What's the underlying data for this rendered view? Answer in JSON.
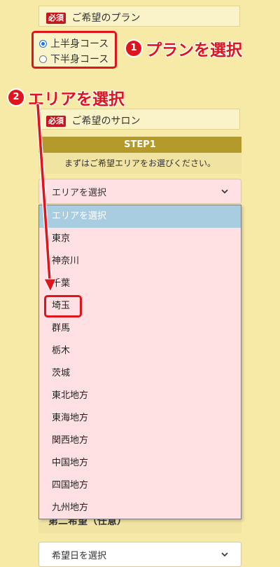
{
  "required_badge": "必須",
  "plan": {
    "title": "ご希望のプラン",
    "options": [
      {
        "label": "上半身コース",
        "checked": true
      },
      {
        "label": "下半身コース",
        "checked": false
      }
    ]
  },
  "salon": {
    "title": "ご希望のサロン"
  },
  "step": {
    "header": "STEP1",
    "description": "まずはご希望エリアをお選びください。"
  },
  "area_select": {
    "value": "エリアを選択",
    "options": [
      "エリアを選択",
      "東京",
      "神奈川",
      "千葉",
      "埼玉",
      "群馬",
      "栃木",
      "茨城",
      "東北地方",
      "東海地方",
      "関西地方",
      "中国地方",
      "四国地方",
      "九州地方"
    ]
  },
  "second_choice": {
    "label": "第二希望（任意）"
  },
  "date_select": {
    "value": "希望日を選択"
  },
  "callouts": {
    "one": {
      "number": "1",
      "text": "プランを選択"
    },
    "two": {
      "number": "2",
      "text": "エリアを選択"
    }
  },
  "colors": {
    "background": "#f7eaa6",
    "accent_red": "#e0141c",
    "step_header": "#b39a2b",
    "dropdown_bg": "#ffe0e3",
    "highlight_option": "#a9cde0"
  }
}
